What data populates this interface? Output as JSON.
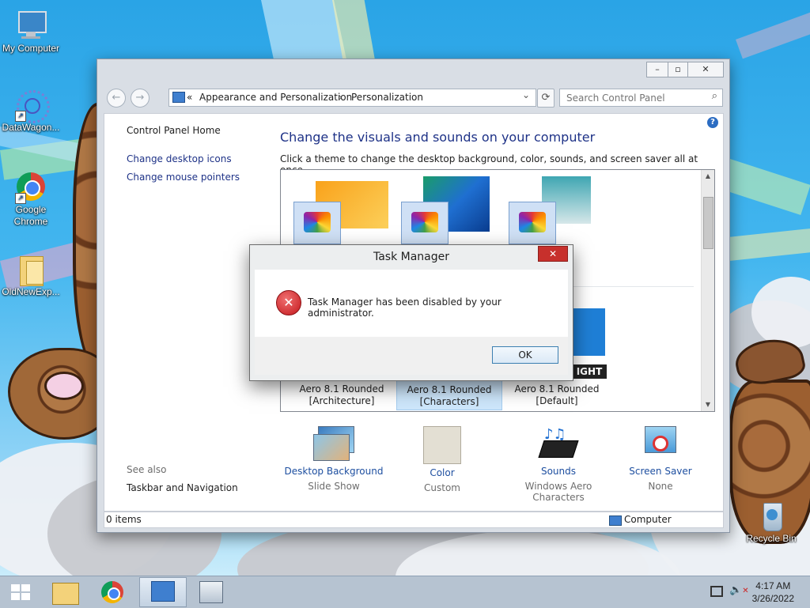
{
  "desktop": {
    "icons": [
      {
        "label": "My Computer"
      },
      {
        "label": "DataWagon..."
      },
      {
        "label": "Google Chrome"
      },
      {
        "label": "OldNewExp..."
      },
      {
        "label": "Recycle Bin"
      }
    ]
  },
  "window": {
    "controls": {
      "minimize": "–",
      "maximize": "▫",
      "close": "✕"
    },
    "address": {
      "prefix": "«",
      "crumb1": "Appearance and Personalization",
      "sep": "›",
      "crumb2": "Personalization",
      "dropdown": "⌄",
      "refresh": "⟳"
    },
    "search": {
      "placeholder": "Search Control Panel",
      "icon": "⌕"
    },
    "help": "?",
    "left_nav": {
      "home": "Control Panel Home",
      "links": [
        "Change desktop icons",
        "Change mouse pointers"
      ],
      "see_also_label": "See also",
      "see_also_links": [
        "Taskbar and Navigation"
      ]
    },
    "heading": "Change the visuals and sounds on your computer",
    "subheading": "Click a theme to change the desktop background, color, sounds, and screen saver all at once.",
    "themes": [
      {
        "line1": "Aero 8.1 Rounded",
        "line2": "[Architecture]"
      },
      {
        "line1": "Aero 8.1 Rounded",
        "line2": "[Characters]"
      },
      {
        "line1": "Aero 8.1 Rounded",
        "line2": "[Default]"
      }
    ],
    "selected_theme_index": 1,
    "partial_theme_text": "IGHT",
    "bottom": [
      {
        "label": "Desktop Background",
        "value": "Slide Show"
      },
      {
        "label": "Color",
        "value": "Custom"
      },
      {
        "label": "Sounds",
        "value": "Windows Aero Characters"
      },
      {
        "label": "Screen Saver",
        "value": "None"
      }
    ],
    "status": {
      "items": "0 items",
      "location": "Computer"
    }
  },
  "dialog": {
    "title": "Task Manager",
    "close": "✕",
    "message": "Task Manager has been disabled by your administrator.",
    "ok": "OK",
    "icon": "error-icon"
  },
  "taskbar": {
    "time": "4:17 AM",
    "date": "3/26/2022"
  },
  "colors": {
    "link": "#1e3287",
    "dialog_close": "#c7302c",
    "taskbar": "#b6c3d1"
  }
}
